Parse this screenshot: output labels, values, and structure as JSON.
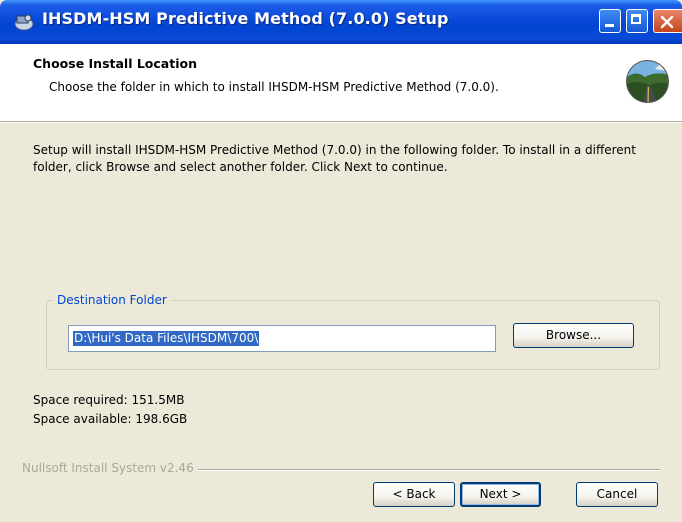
{
  "window": {
    "title": "IHSDM-HSM Predictive Method (7.0.0) Setup",
    "icon": "installer-icon"
  },
  "header": {
    "title": "Choose Install Location",
    "subtitle": "Choose the folder in which to install IHSDM-HSM Predictive Method (7.0.0).",
    "icon": "road-landscape-icon"
  },
  "body": {
    "intro": "Setup will install IHSDM-HSM Predictive Method (7.0.0) in the following folder. To install in a different folder, click Browse and select another folder. Click Next to continue."
  },
  "destination": {
    "legend": "Destination Folder",
    "path": "D:\\Hui's Data Files\\IHSDM\\700\\",
    "browse_label": "Browse..."
  },
  "space": {
    "required": "Space required: 151.5MB",
    "available": "Space available: 198.6GB"
  },
  "footer": {
    "branding": "Nullsoft Install System v2.46",
    "back_label": "< Back",
    "next_label": "Next >",
    "cancel_label": "Cancel"
  }
}
